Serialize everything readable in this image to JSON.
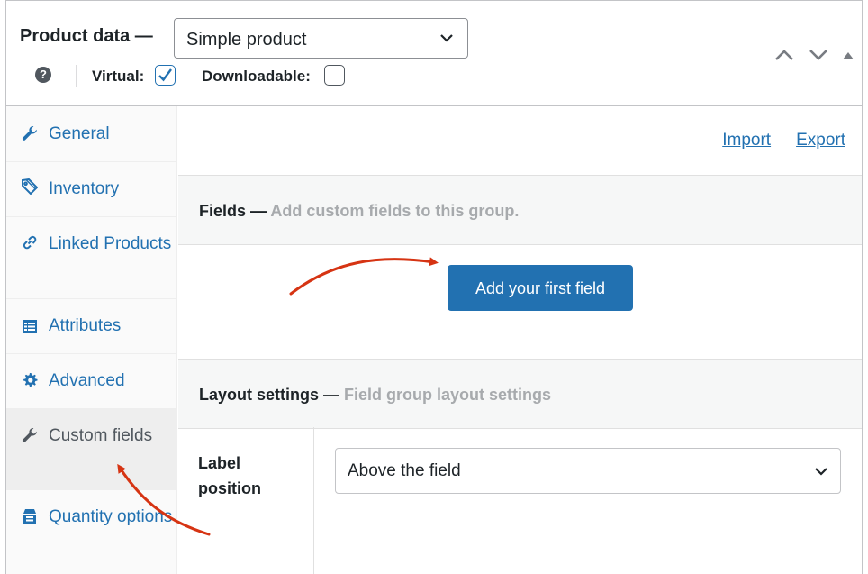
{
  "header": {
    "title": "Product data —",
    "product_type": "Simple product",
    "help_glyph": "?",
    "virtual_label": "Virtual:",
    "virtual_checked": true,
    "downloadable_label": "Downloadable:",
    "downloadable_checked": false
  },
  "sidebar": {
    "items": [
      {
        "label": "General",
        "icon": "wrench-icon"
      },
      {
        "label": "Inventory",
        "icon": "tag-icon"
      },
      {
        "label": "Linked Products",
        "icon": "link-icon"
      },
      {
        "label": "Attributes",
        "icon": "list-icon"
      },
      {
        "label": "Advanced",
        "icon": "gear-icon"
      },
      {
        "label": "Custom fields",
        "icon": "wrench-icon",
        "active": true
      },
      {
        "label": "Quantity options",
        "icon": "quantity-icon"
      }
    ]
  },
  "main": {
    "import_label": "Import",
    "export_label": "Export",
    "fields_title": "Fields —",
    "fields_desc": "Add custom fields to this group.",
    "add_button": "Add your first field",
    "layout_title": "Layout settings —",
    "layout_desc": "Field group layout settings",
    "label_position_label": "Label position",
    "label_position_value": "Above the field"
  },
  "colors": {
    "accent": "#2271b1",
    "arrow": "#d63413",
    "active_tab_bg": "#eeeeee"
  }
}
